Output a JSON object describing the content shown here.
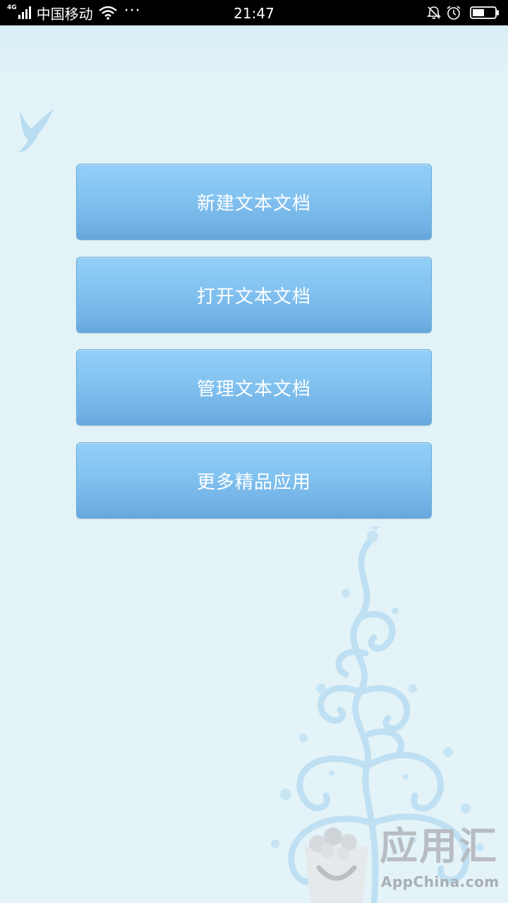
{
  "status_bar": {
    "network": "4G",
    "carrier": "中国移动",
    "more": "···",
    "time": "21:47"
  },
  "menu": {
    "items": [
      {
        "label": "新建文本文档"
      },
      {
        "label": "打开文本文档"
      },
      {
        "label": "管理文本文档"
      },
      {
        "label": "更多精品应用"
      }
    ]
  },
  "watermark": {
    "title": "应用汇",
    "subtitle": "AppChina.com"
  },
  "colors": {
    "background": "#e3f3f8",
    "button_top": "#93d0f8",
    "button_bottom": "#66a6dc",
    "decoration": "#b8dcf0"
  },
  "icons": {
    "status": [
      "signal-icon",
      "wifi-icon",
      "mute-icon",
      "alarm-icon",
      "battery-icon"
    ],
    "decor": [
      "bird-icon",
      "swirl-tree-icon"
    ]
  }
}
